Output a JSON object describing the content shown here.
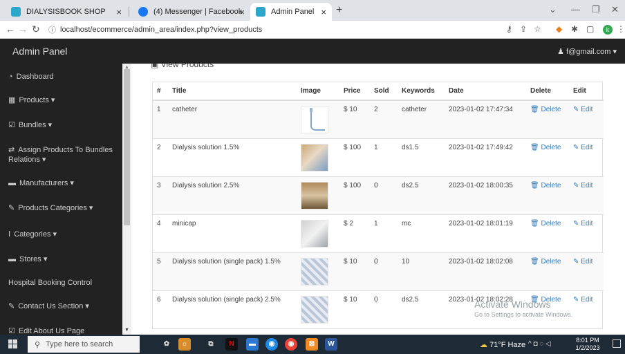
{
  "browser": {
    "tabs": [
      {
        "title": "DIALYSISBOOK SHOP",
        "close": "×"
      },
      {
        "title": "(4) Messenger | Facebook",
        "close": "×"
      },
      {
        "title": "Admin Panel",
        "close": "×"
      }
    ],
    "new_tab": "+",
    "window_controls": [
      "⌄",
      "—",
      "❐",
      "✕"
    ],
    "url": "localhost/ecommerce/admin_area/index.php?view_products",
    "info_icon": "ⓘ"
  },
  "navbar": {
    "brand": "Admin Panel",
    "user": "f@gmail.com"
  },
  "sidebar": {
    "items": [
      {
        "label": "Dashboard",
        "icon": "tachometer-icon",
        "glyph": "◔"
      },
      {
        "label": "Products ▾",
        "icon": "table-icon",
        "glyph": "▦"
      },
      {
        "label": "Bundles ▾",
        "icon": "edit-icon",
        "glyph": "☑"
      },
      {
        "label": "Assign Products To Bundles Relations ▾",
        "icon": "exchange-icon",
        "glyph": "⇄"
      },
      {
        "label": "Manufacturers ▾",
        "icon": "briefcase-icon",
        "glyph": "▬"
      },
      {
        "label": "Products Categories ▾",
        "icon": "pencil-icon",
        "glyph": "✎"
      },
      {
        "label": "Categories ▾",
        "icon": "text-height-icon",
        "glyph": "Ⅰ"
      },
      {
        "label": "Stores ▾",
        "icon": "briefcase-icon",
        "glyph": "▬"
      },
      {
        "label": "Hospital Booking Control",
        "icon": "",
        "glyph": ""
      },
      {
        "label": "Contact Us Section ▾",
        "icon": "pencil-icon",
        "glyph": "✎"
      },
      {
        "label": "Edit About Us Page",
        "icon": "edit-icon",
        "glyph": "☑"
      }
    ]
  },
  "main": {
    "heading": "View Products",
    "columns": [
      "#",
      "Title",
      "Image",
      "Price",
      "Sold",
      "Keywords",
      "Date",
      "Delete",
      "Edit"
    ],
    "rows": [
      {
        "num": "1",
        "title": "catheter",
        "price": "$ 10",
        "sold": "2",
        "keywords": "catheter",
        "date": "2023-01-02 17:47:34",
        "delete": "Delete",
        "edit": "Edit"
      },
      {
        "num": "2",
        "title": "Dialysis solution 1.5%",
        "price": "$ 100",
        "sold": "1",
        "keywords": "ds1.5",
        "date": "2023-01-02 17:49:42",
        "delete": "Delete",
        "edit": "Edit"
      },
      {
        "num": "3",
        "title": "Dialysis solution 2.5%",
        "price": "$ 100",
        "sold": "0",
        "keywords": "ds2.5",
        "date": "2023-01-02 18:00:35",
        "delete": "Delete",
        "edit": "Edit"
      },
      {
        "num": "4",
        "title": "minicap",
        "price": "$ 2",
        "sold": "1",
        "keywords": "mc",
        "date": "2023-01-02 18:01:19",
        "delete": "Delete",
        "edit": "Edit"
      },
      {
        "num": "5",
        "title": "Dialysis solution (single pack) 1.5%",
        "price": "$ 10",
        "sold": "0",
        "keywords": "10",
        "date": "2023-01-02 18:02:08",
        "delete": "Delete",
        "edit": "Edit"
      },
      {
        "num": "6",
        "title": "Dialysis solution (single pack) 2.5%",
        "price": "$ 10",
        "sold": "0",
        "keywords": "ds2.5",
        "date": "2023-01-02 18:02:28",
        "delete": "Delete",
        "edit": "Edit"
      }
    ],
    "watermark_title": "Activate Windows",
    "watermark_sub": "Go to Settings to activate Windows."
  },
  "taskbar": {
    "search_placeholder": "Type here to search",
    "weather": "71°F  Haze",
    "tray": "^ ◘ ◌ ◁",
    "time": "8:01 PM",
    "date": "1/2/2023"
  },
  "colors": {
    "navbar_bg": "#222222",
    "link": "#337ab7",
    "taskbar_bg": "#1f2a37"
  }
}
